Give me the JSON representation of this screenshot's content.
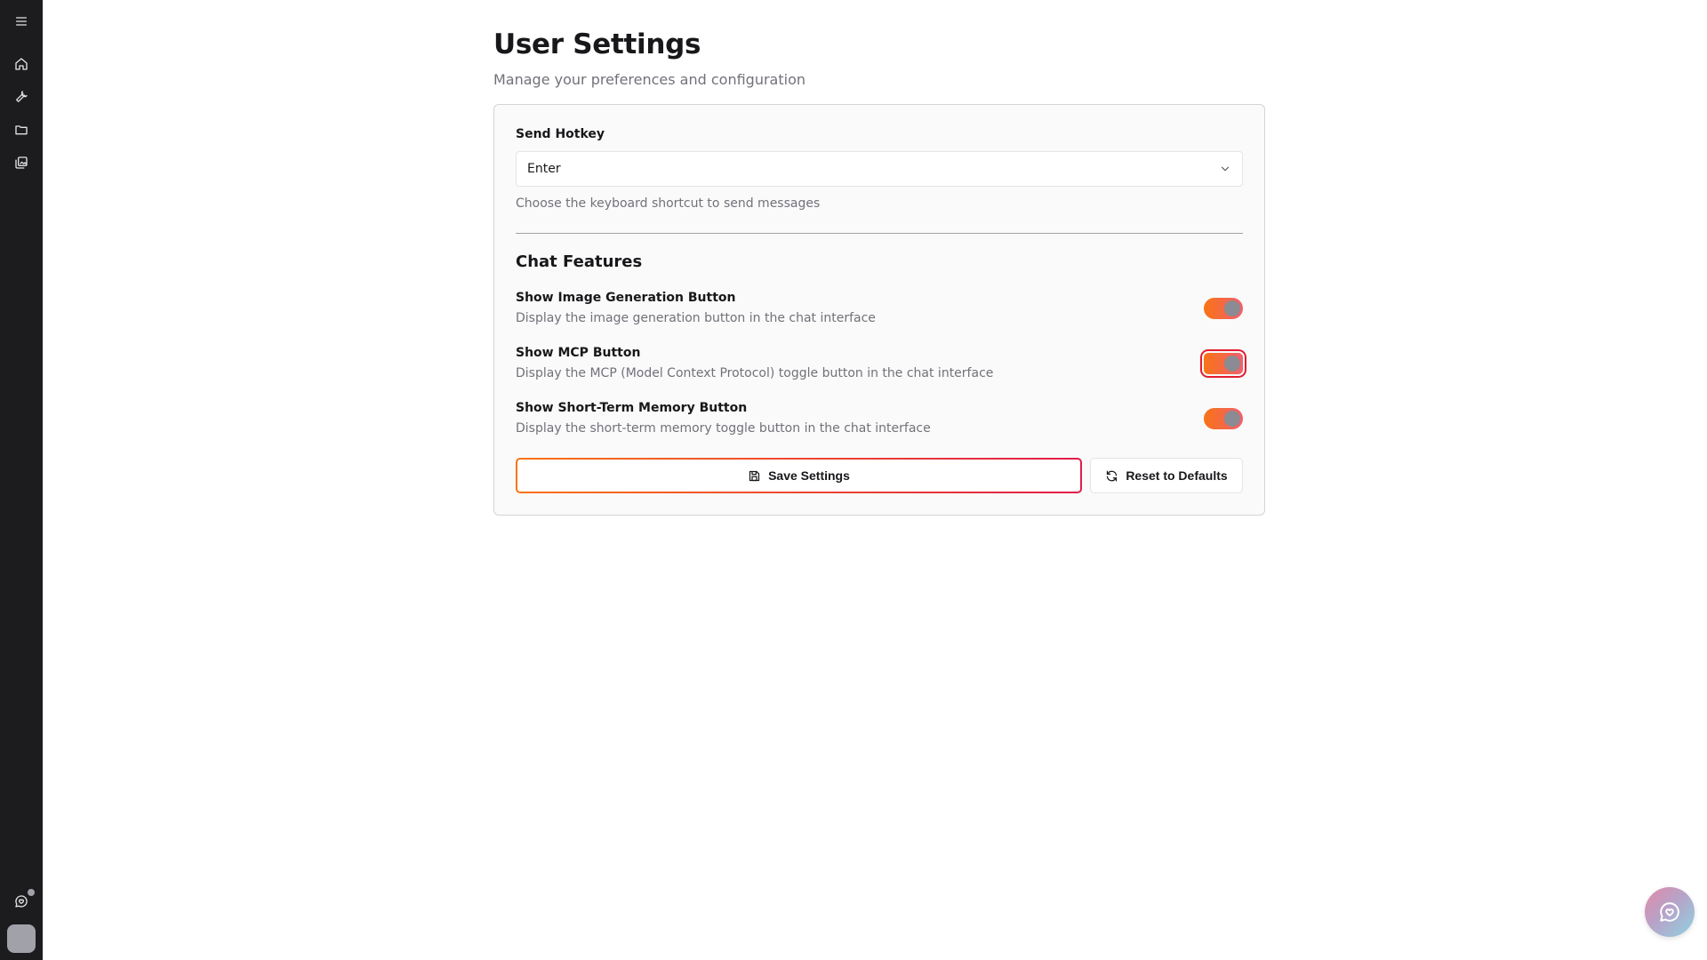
{
  "page": {
    "title": "User Settings",
    "subtitle": "Manage your preferences and configuration"
  },
  "sidebar": {
    "items": [
      {
        "name": "menu",
        "icon": "hamburger-menu-icon"
      },
      {
        "name": "home",
        "icon": "home-icon"
      },
      {
        "name": "tools",
        "icon": "wrench-icon"
      },
      {
        "name": "files",
        "icon": "folder-icon"
      },
      {
        "name": "gallery",
        "icon": "images-icon"
      }
    ],
    "bottom": [
      {
        "name": "support",
        "icon": "chat-heart-icon"
      },
      {
        "name": "avatar",
        "icon": "avatar"
      }
    ]
  },
  "settings": {
    "send_hotkey": {
      "label": "Send Hotkey",
      "value": "Enter",
      "help": "Choose the keyboard shortcut to send messages"
    },
    "chat_features": {
      "title": "Chat Features",
      "toggles": [
        {
          "label": "Show Image Generation Button",
          "description": "Display the image generation button in the chat interface",
          "enabled": true
        },
        {
          "label": "Show MCP Button",
          "description": "Display the MCP (Model Context Protocol) toggle button in the chat interface",
          "enabled": true
        },
        {
          "label": "Show Short-Term Memory Button",
          "description": "Display the short-term memory toggle button in the chat interface",
          "enabled": true
        }
      ]
    },
    "actions": {
      "save_label": "Save Settings",
      "reset_label": "Reset to Defaults"
    }
  },
  "colors": {
    "sidebar_bg": "#1c1c1f",
    "accent_start": "#f97316",
    "accent_end": "#e11d48",
    "focus_ring": "#e11d2e"
  }
}
